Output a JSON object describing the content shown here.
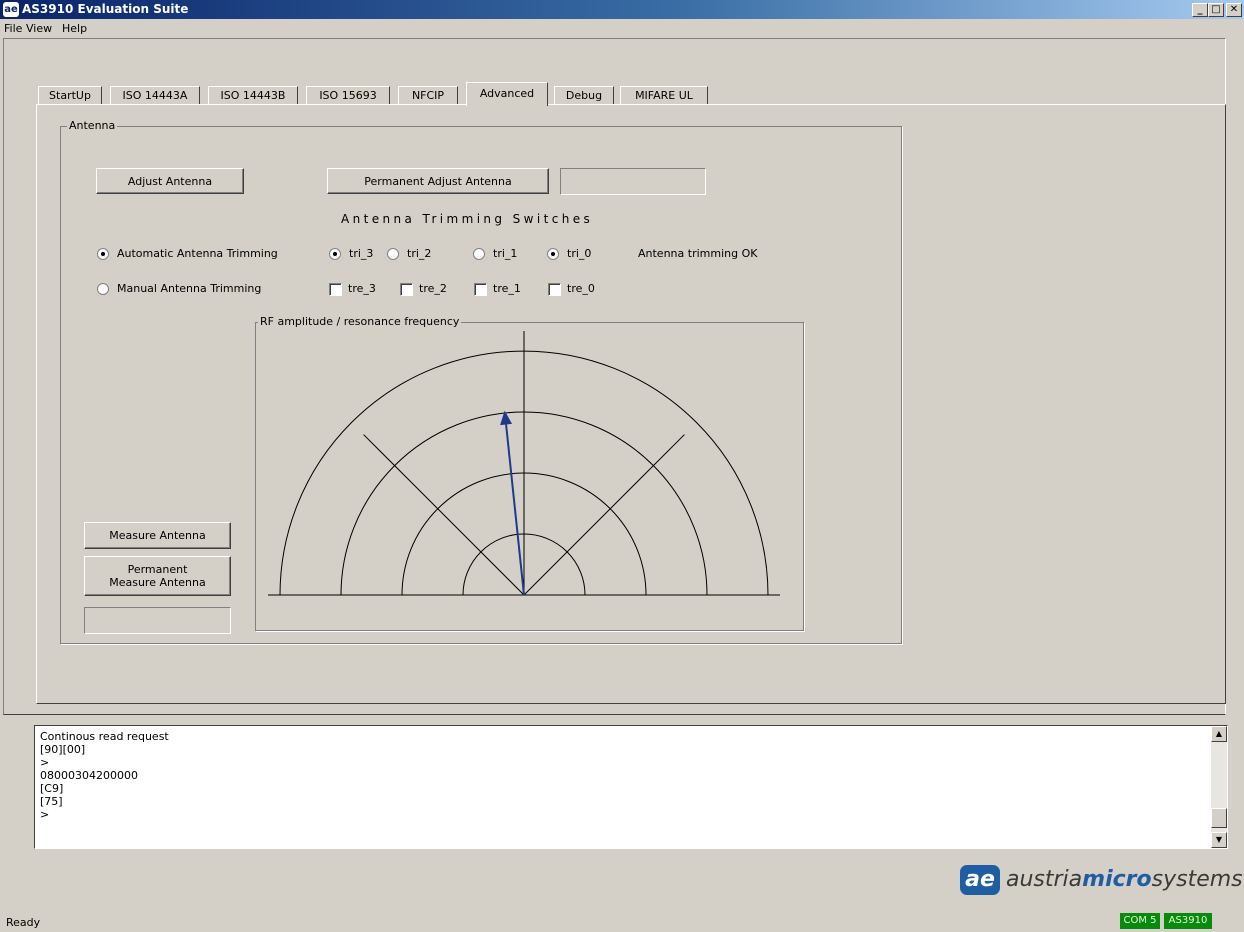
{
  "window": {
    "title": "AS3910 Evaluation Suite",
    "app_icon": "ae-logo-icon",
    "minimize": "_",
    "maximize": "□",
    "close": "✕"
  },
  "menu": [
    "File",
    "View",
    "Help"
  ],
  "tabs": [
    {
      "label": "StartUp",
      "active": false
    },
    {
      "label": "ISO 14443A",
      "active": false
    },
    {
      "label": "ISO 14443B",
      "active": false
    },
    {
      "label": "ISO 15693",
      "active": false
    },
    {
      "label": "NFCIP",
      "active": false
    },
    {
      "label": "Advanced",
      "active": true
    },
    {
      "label": "Debug",
      "active": false
    },
    {
      "label": "MIFARE UL",
      "active": false
    }
  ],
  "antenna": {
    "group_label": "Antenna",
    "adjust_button": "Adjust Antenna",
    "permanent_adjust_button": "Permanent Adjust Antenna",
    "permanent_adjust_value": "",
    "trimming_switches_label": "Antenna Trimming Switches",
    "automatic_label": "Automatic Antenna Trimming",
    "automatic_selected": true,
    "manual_label": "Manual Antenna Trimming",
    "manual_selected": false,
    "tri_switches": [
      {
        "label": "tri_3",
        "checked": true
      },
      {
        "label": "tri_2",
        "checked": false
      },
      {
        "label": "tri_1",
        "checked": false
      },
      {
        "label": "tri_0",
        "checked": true
      }
    ],
    "tre_switches": [
      {
        "label": "tre_3",
        "checked": false
      },
      {
        "label": "tre_2",
        "checked": false
      },
      {
        "label": "tre_1",
        "checked": false
      },
      {
        "label": "tre_0",
        "checked": false
      }
    ],
    "status_text": "Antenna trimming OK",
    "measure_button": "Measure Antenna",
    "permanent_measure_button_line1": "Permanent",
    "permanent_measure_button_line2": "Measure Antenna",
    "permanent_measure_value": "",
    "plot_label": "RF amplitude / resonance frequency",
    "plot": {
      "rings": 4,
      "pointer_amplitude_fraction": 0.76,
      "pointer_angle_deg": 96,
      "pointer_color": "#1f3a8a"
    }
  },
  "log": {
    "lines": [
      "Continous read request",
      "[90][00]",
      ">",
      "08000304200000",
      "[C9]",
      "[75]",
      ">"
    ],
    "scroll_up": "▲",
    "scroll_down": "▼"
  },
  "logo": {
    "prefix": "austria",
    "middle": "micro",
    "suffix": "systems",
    "mark": "ae"
  },
  "status": {
    "text": "Ready",
    "badges": [
      "COM 5",
      "AS3910"
    ],
    "badge_color": "#0a8a0a"
  }
}
